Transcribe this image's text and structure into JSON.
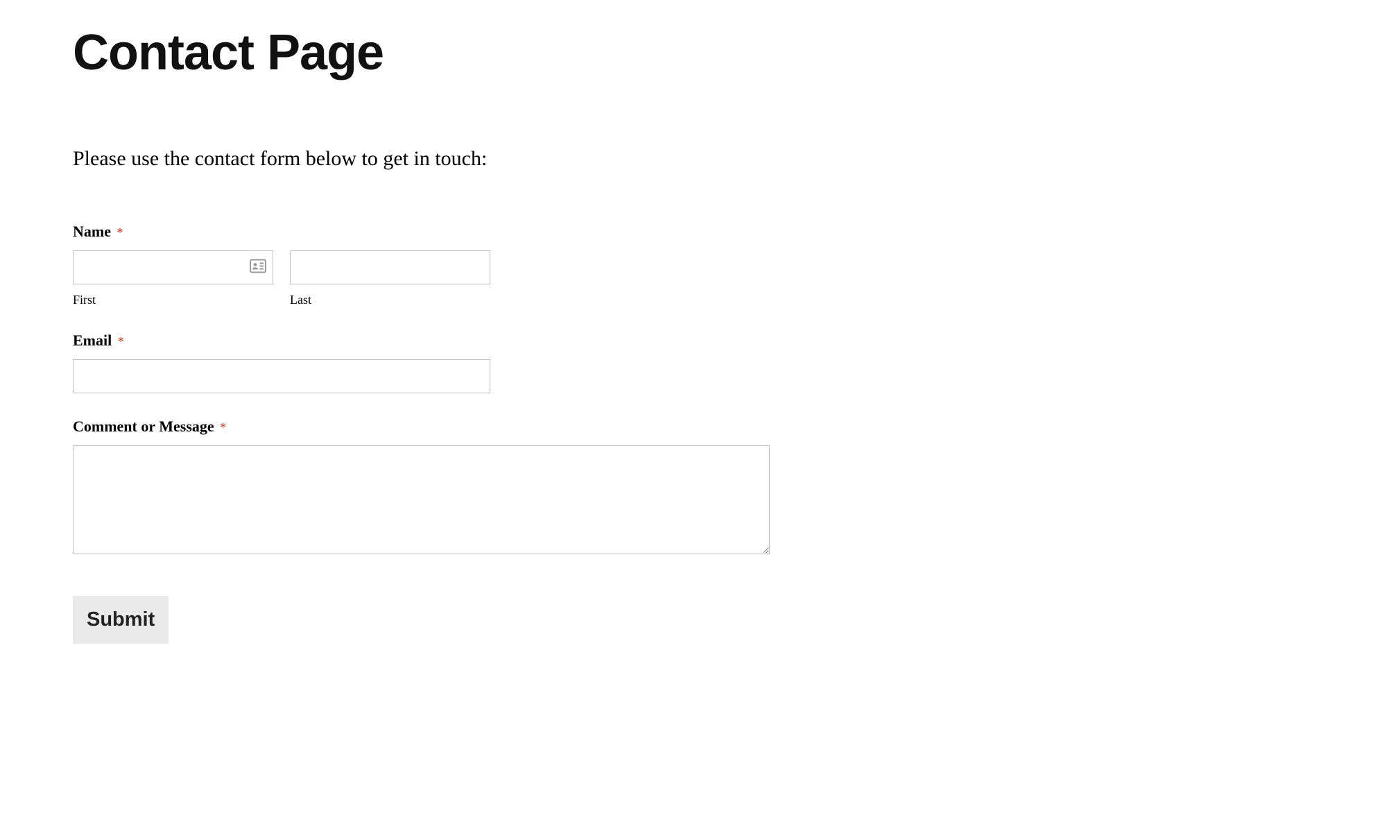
{
  "page": {
    "title": "Contact Page",
    "intro": "Please use the contact form below to get in touch:"
  },
  "form": {
    "name": {
      "label": "Name",
      "required": "*",
      "first": {
        "sublabel": "First",
        "value": ""
      },
      "last": {
        "sublabel": "Last",
        "value": ""
      }
    },
    "email": {
      "label": "Email",
      "required": "*",
      "value": ""
    },
    "message": {
      "label": "Comment or Message",
      "required": "*",
      "value": ""
    },
    "submit_label": "Submit"
  },
  "icons": {
    "id_card": "id-card-icon"
  }
}
